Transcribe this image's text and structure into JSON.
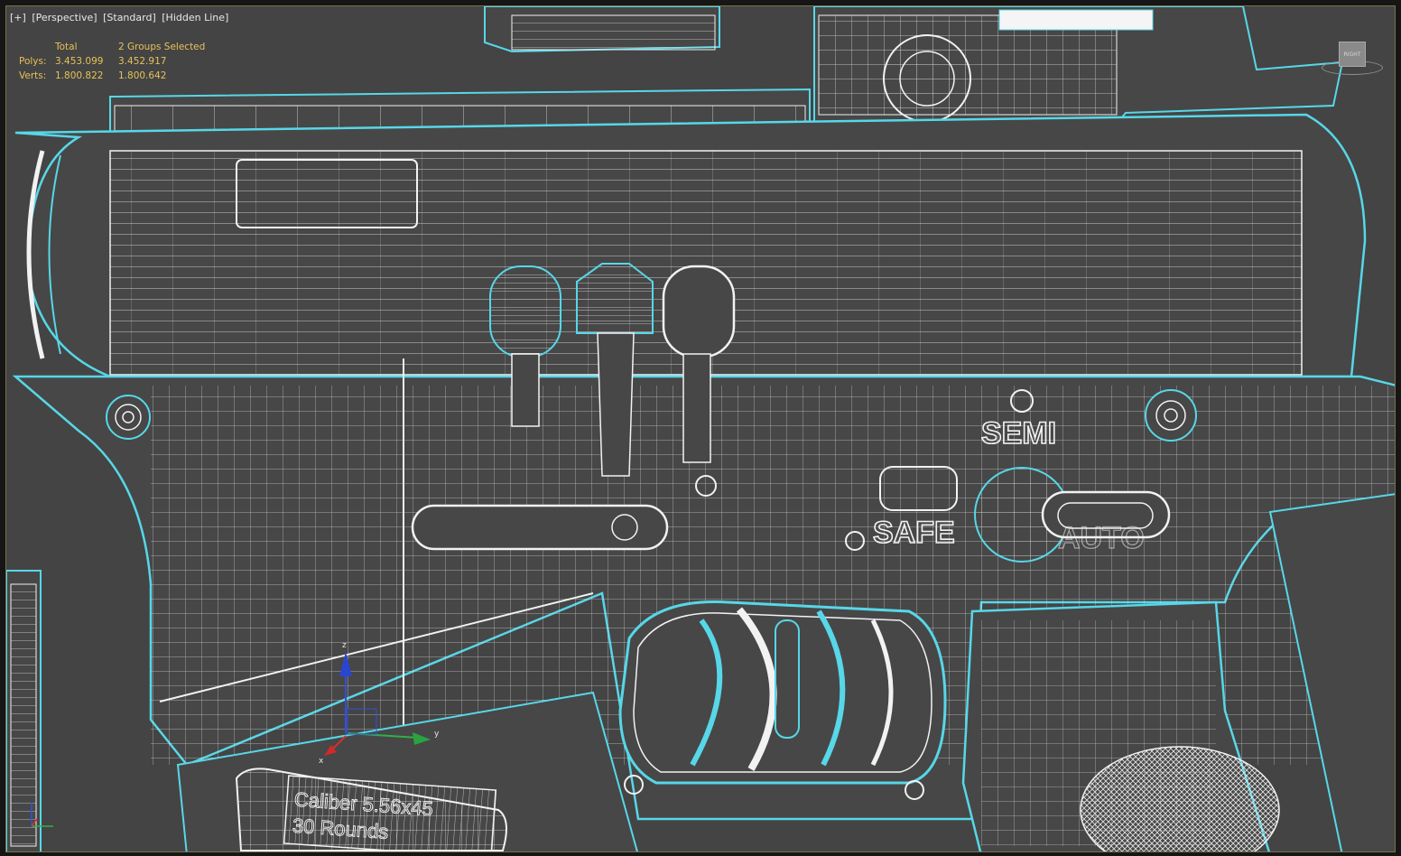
{
  "viewport": {
    "label_items": [
      "[+]",
      "[Perspective]",
      "[Standard]",
      "[Hidden Line]"
    ]
  },
  "stats": {
    "header_total": "Total",
    "header_selection": "2 Groups Selected",
    "polys_label": "Polys:",
    "polys_total": "3.453.099",
    "polys_selected": "3.452.917",
    "verts_label": "Verts:",
    "verts_total": "1.800.822",
    "verts_selected": "1.800.642"
  },
  "engravings": {
    "semi": "SEMI",
    "safe": "SAFE",
    "auto": "AUTO",
    "magazine_line1": "Caliber 5.56x45",
    "magazine_line2": "30 Rounds"
  },
  "viewcube": {
    "face_label": "RIGHT"
  },
  "gizmo": {
    "axis_x": "x",
    "axis_y": "y",
    "axis_z": "z"
  },
  "colors": {
    "viewport_bg": "#444444",
    "outline_cyan": "#57d7e8",
    "wire_white": "#f2f2f2",
    "stats_yellow": "#e6c25a",
    "viewport_border": "#7a7148"
  }
}
